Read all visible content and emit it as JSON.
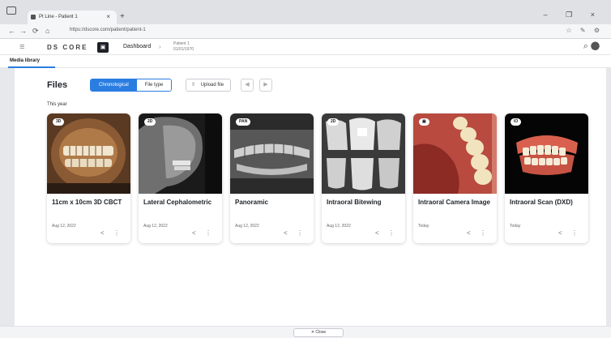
{
  "browser": {
    "tab_title": "Pt Line - Patient 1",
    "url": "https://dscore.com/patient/patient-1",
    "new_tab": "+",
    "tab_close": "×",
    "window_controls": "–  ❐  ×",
    "nav_back": "←",
    "nav_forward": "→",
    "nav_reload": "⟳",
    "nav_home": "⌂",
    "addr_icons": "☆ ✎ ⚙"
  },
  "app": {
    "menu_icon": "≡",
    "logo": "DS CORE",
    "brand_glyph": "▣",
    "dashboard": "Dashboard",
    "breadcrumb_sep": "›",
    "patient_name": "Patient 1",
    "patient_sub": "01/01/1970",
    "right_icons": "⌕ ⬤"
  },
  "subnav": {
    "tab": "Media library"
  },
  "panel": {
    "title": "Files",
    "view_options": [
      "Chronological",
      "File type"
    ],
    "upload_label": "Upload file",
    "upload_icon": "⇧",
    "icon_btn1": "◀",
    "icon_btn2": "▶",
    "section_label": "This year"
  },
  "cards": [
    {
      "badge": "3D",
      "title": "11cm x 10cm 3D CBCT",
      "date": "Aug 12, 2022",
      "share_icon": "<",
      "menu_icon": "⋮"
    },
    {
      "badge": "2D",
      "title": "Lateral Cephalometric",
      "date": "Aug 12, 2022",
      "share_icon": "<",
      "menu_icon": "⋮"
    },
    {
      "badge": "PAN",
      "title": "Panoramic",
      "date": "Aug 12, 2022",
      "share_icon": "<",
      "menu_icon": "⋮"
    },
    {
      "badge": "2D",
      "title": "Intraoral Bitewing",
      "date": "Aug 12, 2022",
      "share_icon": "<",
      "menu_icon": "⋮"
    },
    {
      "badge": "▣",
      "title": "Intraoral Camera Image",
      "date": "Today",
      "share_icon": "<",
      "menu_icon": "⋮"
    },
    {
      "badge": "IO",
      "title": "Intraoral Scan (DXD)",
      "date": "Today",
      "share_icon": "<",
      "menu_icon": "⋮"
    }
  ],
  "footer": {
    "close_label": "✕  Close"
  },
  "colors": {
    "accent": "#2a7de1",
    "panel_bg": "#ffffff",
    "page_bg": "#e6e8eb"
  }
}
